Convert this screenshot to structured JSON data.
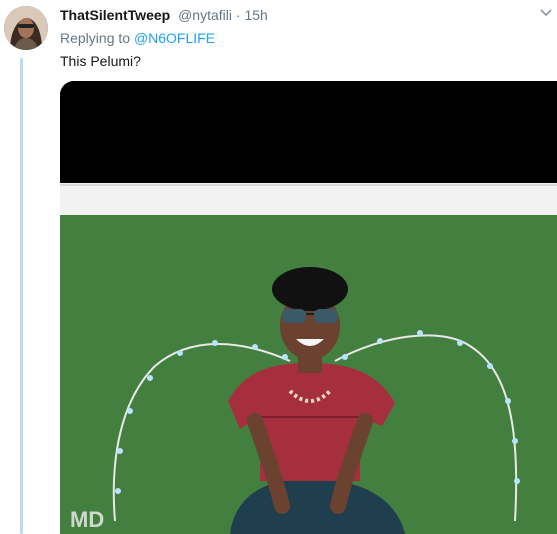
{
  "tweet": {
    "display_name": "ThatSilentTweep",
    "handle": "@nytafili",
    "separator": "·",
    "timestamp": "15h",
    "replying_prefix": "Replying to",
    "replying_to": "@N6OFLIFE",
    "body": "This Pelumi?",
    "more_icon": "chevron-down-icon"
  },
  "media": {
    "watermark": "MD",
    "colors": {
      "grass": "#3f7a3c",
      "shirt": "#a62f3d",
      "lights_wire": "#e8e8e8"
    }
  },
  "theme": {
    "link": "#1da1f2",
    "muted": "#657786",
    "thread_line": "#b6dcf3"
  }
}
